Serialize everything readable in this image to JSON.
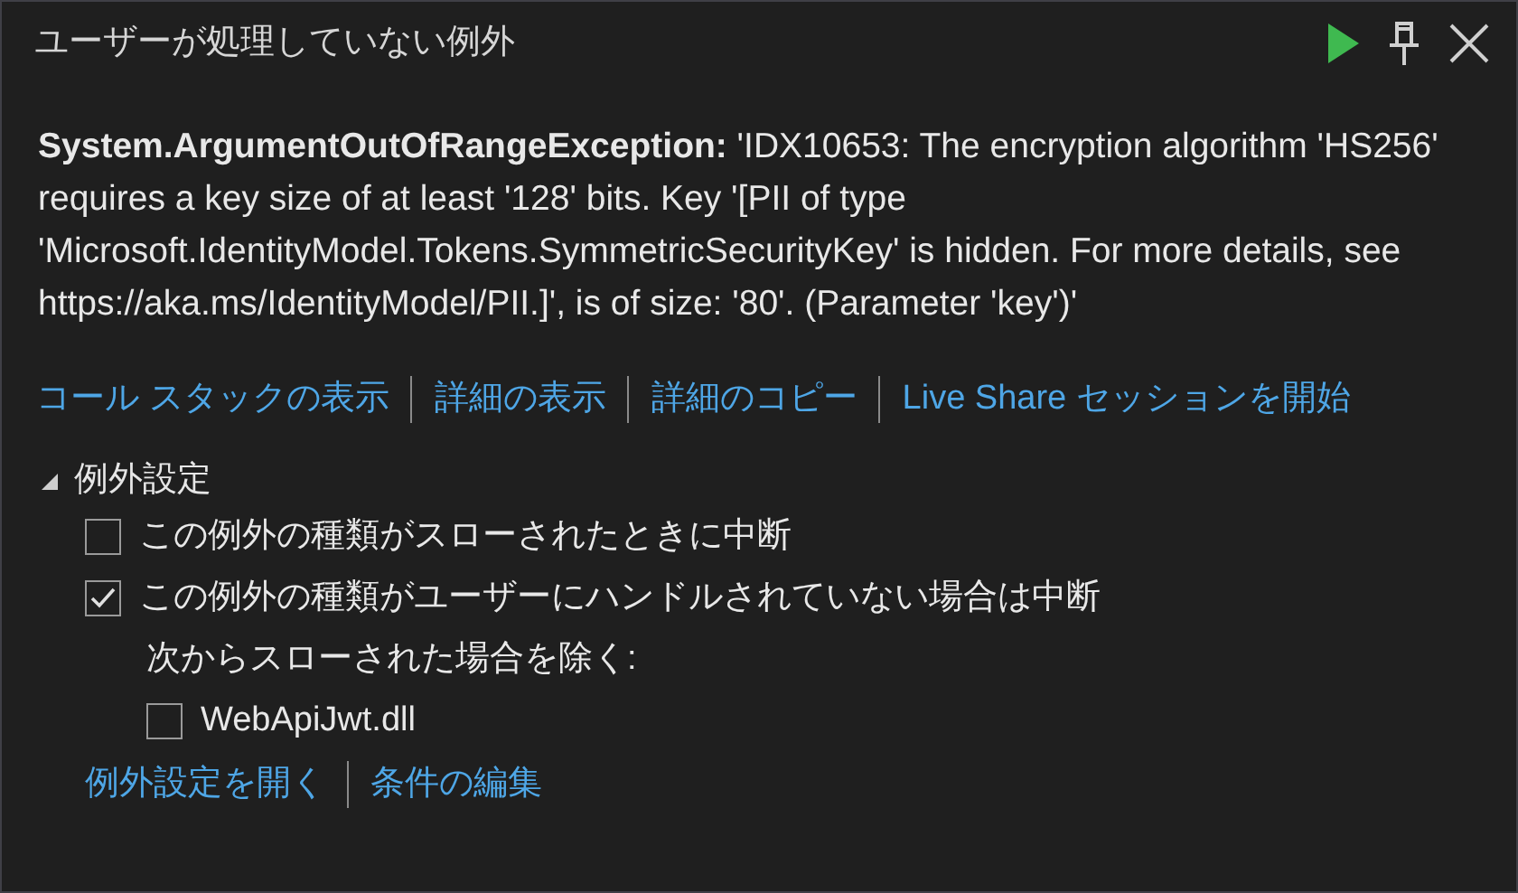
{
  "title": "ユーザーが処理していない例外",
  "message": "**System.ArgumentOutOfRangeException:** 'IDX10653: The encryption algorithm 'HS256' requires a key size of at least '128' bits. Key '[PII of type 'Microsoft.IdentityModel.Tokens.SymmetricSecurityKey' is hidden. For more details, see https://aka.ms/IdentityModel/PII.]', is of size: '80'. (Parameter 'key')'",
  "links": [
    "コール スタックの表示",
    "詳細の表示",
    "詳細のコピー",
    "Live Share セッションを開始"
  ],
  "exception_settings": {
    "label": "例外設定",
    "expanded": true,
    "options": [
      {
        "kind": "checkbox",
        "label": "この例外の種類がスローされたときに中断",
        "checked": false
      },
      {
        "kind": "checkbox",
        "label": "この例外の種類がユーザーにハンドルされていない場合は中断",
        "checked": true,
        "children": [
          {
            "kind": "label",
            "label": "次からスローされた場合を除く:"
          },
          {
            "kind": "checkbox",
            "label": "WebApiJwt.dll",
            "checked": false
          }
        ]
      }
    ],
    "links": [
      "例外設定を開く",
      "条件の編集"
    ]
  }
}
